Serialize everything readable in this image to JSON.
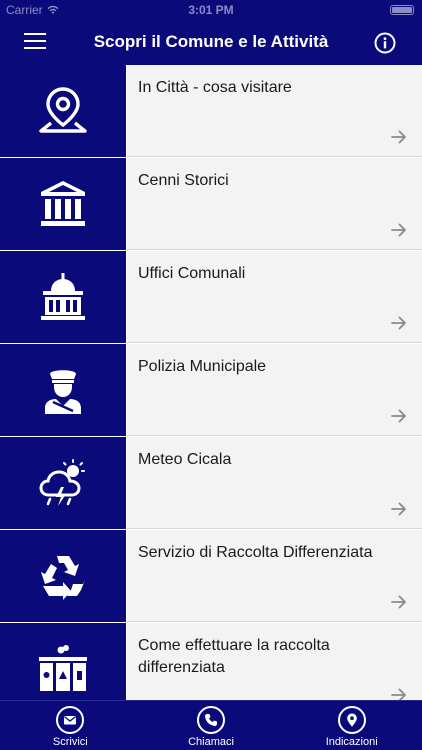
{
  "status_bar": {
    "carrier": "Carrier",
    "time": "3:01 PM"
  },
  "nav": {
    "title": "Scopri il Comune e le Attività",
    "menu_icon": "hamburger-icon",
    "info_icon": "info-icon"
  },
  "list": {
    "items": [
      {
        "label": "In Città - cosa visitare",
        "icon": "location-pin-icon"
      },
      {
        "label": "Cenni Storici",
        "icon": "museum-icon"
      },
      {
        "label": "Uffici Comunali",
        "icon": "town-hall-icon"
      },
      {
        "label": "Polizia Municipale",
        "icon": "police-officer-icon"
      },
      {
        "label": "Meteo Cicala",
        "icon": "weather-storm-icon"
      },
      {
        "label": "Servizio di Raccolta Differenziata",
        "icon": "recycle-icon"
      },
      {
        "label": "Come effettuare la raccolta differenziata",
        "icon": "waste-bins-icon"
      }
    ]
  },
  "tabs": [
    {
      "label": "Scrivici",
      "icon": "envelope-icon"
    },
    {
      "label": "Chiamaci",
      "icon": "phone-icon"
    },
    {
      "label": "Indicazioni",
      "icon": "map-pin-icon"
    }
  ],
  "colors": {
    "primary": "#0a0a7a",
    "row_background": "#f3f3f3",
    "arrow": "#8a8a8a"
  }
}
